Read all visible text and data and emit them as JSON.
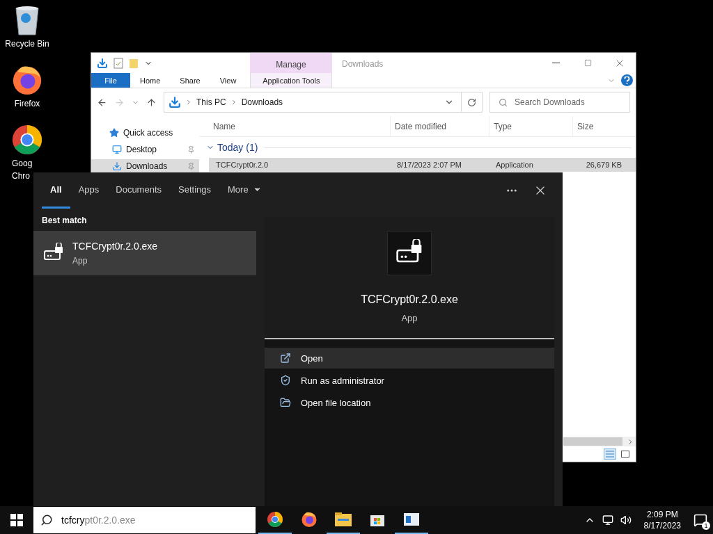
{
  "desktop_icons": [
    {
      "kind": "recycle",
      "lines": [
        "Recycle Bin"
      ]
    },
    {
      "kind": "firefox",
      "lines": [
        "Firefox"
      ]
    },
    {
      "kind": "chrome",
      "lines": [
        "Goog",
        "Chro"
      ]
    }
  ],
  "explorer": {
    "title": "Downloads",
    "contextual_tab": "Manage",
    "ribbon_tabs": [
      {
        "label": "File",
        "kind": "file"
      },
      {
        "label": "Home",
        "kind": "plain"
      },
      {
        "label": "Share",
        "kind": "plain"
      },
      {
        "label": "View",
        "kind": "plain"
      },
      {
        "label": "Application Tools",
        "kind": "contextual"
      }
    ],
    "breadcrumbs": [
      "This PC",
      "Downloads"
    ],
    "search_placeholder": "Search Downloads",
    "sidebar": [
      {
        "label": "Quick access",
        "kind": "star",
        "pinned": false,
        "selected": false
      },
      {
        "label": "Desktop",
        "kind": "desktop",
        "pinned": true,
        "selected": false
      },
      {
        "label": "Downloads",
        "kind": "downloads",
        "pinned": true,
        "selected": true
      }
    ],
    "columns": [
      "Name",
      "Date modified",
      "Type",
      "Size"
    ],
    "groups": [
      {
        "label": "Today (1)",
        "expanded": true,
        "rows": [
          {
            "name": "TCFCrypt0r.2.0",
            "date": "8/17/2023 2:07 PM",
            "type": "Application",
            "size": "26,679 KB",
            "selected": true
          }
        ]
      }
    ]
  },
  "search": {
    "tabs": [
      {
        "label": "All",
        "selected": true,
        "dropdown": false
      },
      {
        "label": "Apps",
        "selected": false,
        "dropdown": false
      },
      {
        "label": "Documents",
        "selected": false,
        "dropdown": false
      },
      {
        "label": "Settings",
        "selected": false,
        "dropdown": false
      },
      {
        "label": "More",
        "selected": false,
        "dropdown": true
      }
    ],
    "section": "Best match",
    "results": [
      {
        "name": "TCFCrypt0r.2.0.exe",
        "type": "App",
        "selected": true
      }
    ],
    "preview": {
      "name": "TCFCrypt0r.2.0.exe",
      "type": "App"
    },
    "actions": [
      {
        "label": "Open",
        "kind": "open",
        "hovered": true
      },
      {
        "label": "Run as administrator",
        "kind": "admin",
        "hovered": false
      },
      {
        "label": "Open file location",
        "kind": "location",
        "hovered": false
      }
    ]
  },
  "taskbar": {
    "search": {
      "typed": "tcfcry",
      "suggestion": "pt0r.2.0.exe"
    },
    "apps": [
      {
        "kind": "chrome",
        "running": true
      },
      {
        "kind": "firefox",
        "running": false
      },
      {
        "kind": "explorer",
        "running": true
      },
      {
        "kind": "store",
        "running": false
      },
      {
        "kind": "window",
        "running": true
      }
    ],
    "time": "2:09 PM",
    "date": "8/17/2023",
    "notifications": "1"
  }
}
